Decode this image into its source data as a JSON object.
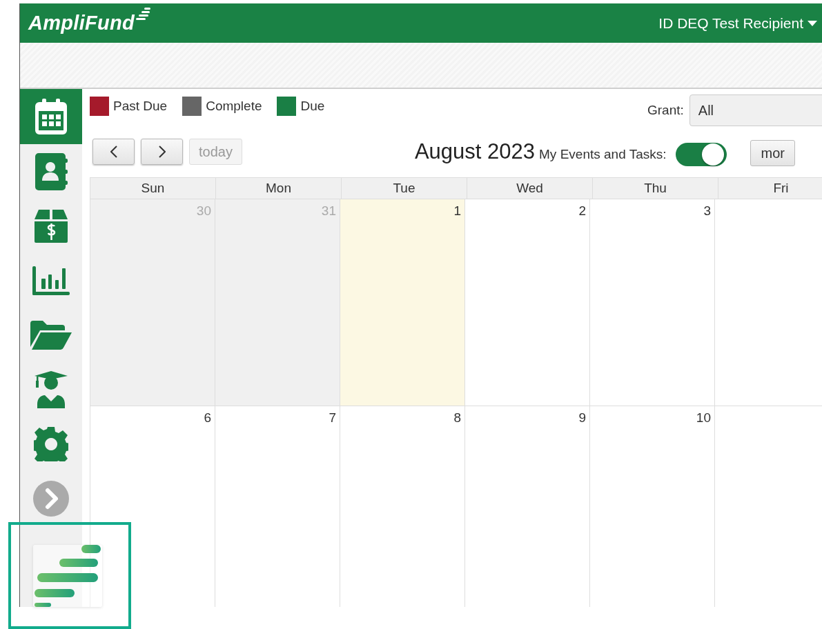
{
  "header": {
    "logo": "AmpliFund",
    "account": "ID DEQ Test Recipient"
  },
  "sidebar": {
    "items": [
      {
        "selected": true
      },
      {
        "selected": false
      },
      {
        "selected": false
      },
      {
        "selected": false
      },
      {
        "selected": false
      },
      {
        "selected": false
      },
      {
        "selected": false
      },
      {
        "selected": false
      }
    ]
  },
  "legend": [
    {
      "label": "Past Due",
      "color": "#a51a2b"
    },
    {
      "label": "Complete",
      "color": "#666666"
    },
    {
      "label": "Due",
      "color": "#1a7f45"
    }
  ],
  "grant_filter": {
    "label": "Grant:",
    "value": "All"
  },
  "nav_buttons": [
    {
      "kind": "prev",
      "disabled": false
    },
    {
      "kind": "next",
      "disabled": false
    },
    {
      "kind": "text",
      "label": "today",
      "disabled": true
    }
  ],
  "title": "August 2023",
  "my_events": {
    "label": "My Events and Tasks:",
    "on": true
  },
  "view_button": "mor",
  "calendar": {
    "columns": [
      "Sun",
      "Mon",
      "Tue",
      "Wed",
      "Thu",
      "Fri"
    ],
    "weeks": [
      [
        {
          "day": "30",
          "other_month": true,
          "today": false
        },
        {
          "day": "31",
          "other_month": true,
          "today": false
        },
        {
          "day": "1",
          "other_month": false,
          "today": true
        },
        {
          "day": "2",
          "other_month": false,
          "today": false
        },
        {
          "day": "3",
          "other_month": false,
          "today": false
        },
        {
          "other_month": false,
          "today": false
        }
      ],
      [
        {
          "day": "6",
          "other_month": false,
          "today": false
        },
        {
          "day": "7",
          "other_month": false,
          "today": false
        },
        {
          "day": "8",
          "other_month": false,
          "today": false
        },
        {
          "day": "9",
          "other_month": false,
          "today": false
        },
        {
          "day": "10",
          "other_month": false,
          "today": false
        },
        {
          "other_month": false,
          "today": false
        }
      ]
    ]
  }
}
